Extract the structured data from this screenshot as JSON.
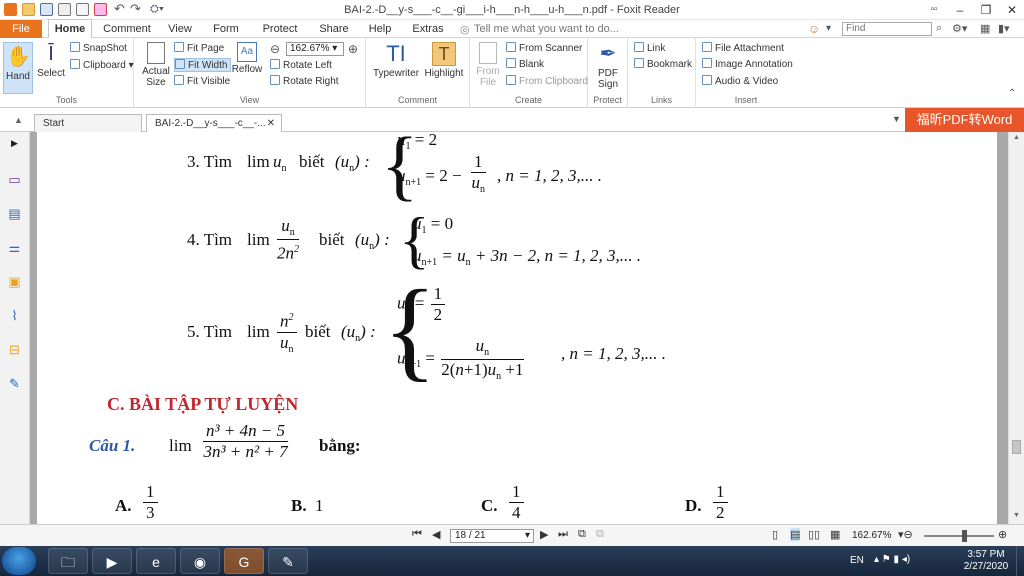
{
  "window": {
    "title": "BAI-2.-D__y-s___-c__-gi___i-h___n-h___u-h___n.pdf - Foxit Reader"
  },
  "menu": {
    "file": "File",
    "home": "Home",
    "comment": "Comment",
    "view": "View",
    "form": "Form",
    "protect": "Protect",
    "share": "Share",
    "help": "Help",
    "extras": "Extras",
    "tellme": "Tell me what you want to do...",
    "find_placeholder": "Find"
  },
  "ribbon": {
    "tools": {
      "hand": "Hand",
      "select": "Select",
      "snapshot": "SnapShot",
      "clipboard": "Clipboard",
      "label": "Tools"
    },
    "view": {
      "actual_size": "Actual Size",
      "fit_page": "Fit Page",
      "fit_width": "Fit Width",
      "fit_visible": "Fit Visible",
      "reflow": "Reflow",
      "zoom": "162.67%",
      "rotate_left": "Rotate Left",
      "rotate_right": "Rotate Right",
      "label": "View"
    },
    "comment": {
      "typewriter": "Typewriter",
      "highlight": "Highlight",
      "label": "Comment"
    },
    "create": {
      "from_file": "From File",
      "from_scanner": "From Scanner",
      "blank": "Blank",
      "from_clipboard": "From Clipboard",
      "label": "Create"
    },
    "protect": {
      "pdf_sign": "PDF Sign",
      "label": "Protect"
    },
    "links": {
      "link": "Link",
      "bookmark": "Bookmark",
      "label": "Links"
    },
    "insert": {
      "file_attachment": "File Attachment",
      "image_annotation": "Image Annotation",
      "audio_video": "Audio & Video",
      "label": "Insert"
    }
  },
  "tabs": {
    "start": "Start",
    "doc": "BAI-2.-D__y-s___-c__-...",
    "banner": "福昕PDF转Word"
  },
  "doc": {
    "p3": {
      "num": "3. Tìm",
      "lim": "lim",
      "biet": "biết",
      "u1": "= 2",
      "rec": "= 2 −",
      "tail": ", n = 1, 2, 3,... ."
    },
    "p4": {
      "num": "4. Tìm",
      "lim": "lim",
      "biet": "biết",
      "u1": "= 0",
      "rec": "= u",
      "rec2": "+ 3n − 2,  n = 1, 2, 3,... ."
    },
    "p5": {
      "num": "5. Tìm",
      "lim": "lim",
      "biet": "biết",
      "u1": "=",
      "tail": ", n = 1, 2, 3,... ."
    },
    "section": "C. BÀI TẬP TỰ LUYỆN",
    "q1": {
      "label": "Câu 1.",
      "lim": "lim",
      "num": "n³ + 4n − 5",
      "den": "3n³ + n² + 7",
      "bang": "bằng:"
    },
    "answers": {
      "a": "A.",
      "a_val": "1/3",
      "b": "B.",
      "b_val": "1",
      "c": "C.",
      "c_val": "1/4",
      "d": "D.",
      "d_val": "1/2"
    }
  },
  "status": {
    "page": "18 / 21",
    "zoom": "162.67%"
  },
  "taskbar": {
    "lang": "EN",
    "time": "3:57 PM",
    "date": "2/27/2020"
  },
  "colors": {
    "accent": "#e8731c",
    "section_red": "#c1272d",
    "question_blue": "#2a5aa8",
    "banner": "#e8552a"
  }
}
